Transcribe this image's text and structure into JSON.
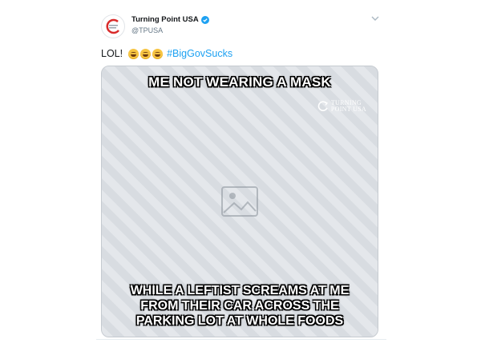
{
  "tweet": {
    "author": {
      "display_name": "Turning Point USA",
      "handle": "@TPUSA",
      "verified_icon": "verified-badge-icon",
      "avatar_icon": "turning-point-logo"
    },
    "text": {
      "prefix": "LOL!",
      "emojis": [
        "face-with-tears-of-joy",
        "face-with-tears-of-joy",
        "face-with-tears-of-joy"
      ],
      "hashtag": "#BigGovSucks"
    },
    "media": {
      "caption_top": "ME NOT WEARING A MASK",
      "caption_bottom": [
        "WHILE A LEFTIST SCREAMS AT ME",
        "FROM THEIR CAR ACROSS THE",
        "PARKING LOT AT WHOLE FOODS"
      ],
      "watermark": [
        "TURNING",
        "POINT USA"
      ]
    },
    "menu_icon": "chevron-down-icon"
  },
  "colors": {
    "accent": "#1da1f2",
    "text": "#14171a",
    "muted": "#657786",
    "brand_red": "#d92b2b"
  }
}
